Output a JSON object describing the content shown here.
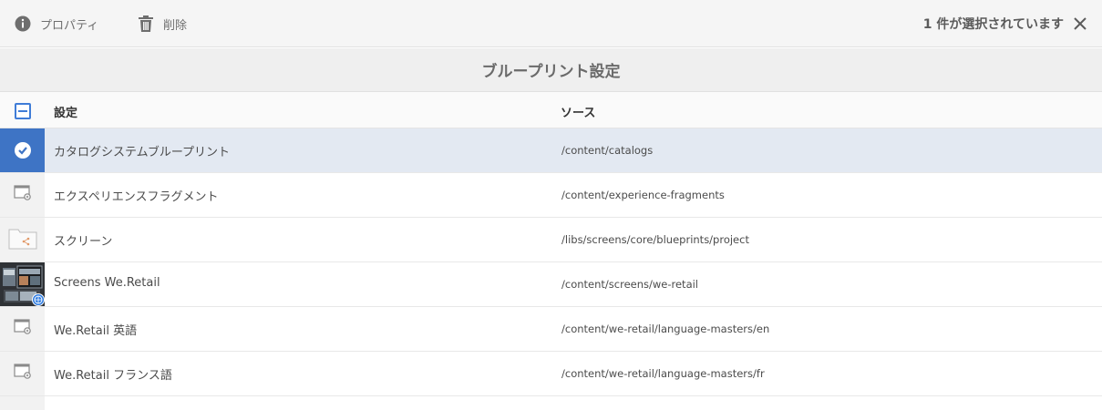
{
  "actionbar": {
    "properties_label": "プロパティ",
    "delete_label": "削除",
    "selection_text": "1 件が選択されています"
  },
  "title": "ブループリント設定",
  "table": {
    "headers": {
      "setting": "設定",
      "source": "ソース"
    },
    "rows": [
      {
        "name": "カタログシステムブループリント",
        "source": "/content/catalogs",
        "selected": true,
        "icon": "checkmark-circle-icon"
      },
      {
        "name": "エクスペリエンスフラグメント",
        "source": "/content/experience-fragments",
        "selected": false,
        "icon": "page-gear-icon"
      },
      {
        "name": "スクリーン",
        "source": "/libs/screens/core/blueprints/project",
        "selected": false,
        "icon": "folder-share-icon"
      },
      {
        "name": "Screens We.Retail",
        "source": "/content/screens/we-retail",
        "selected": false,
        "icon": "screens-thumbnail"
      },
      {
        "name": "We.Retail 英語",
        "source": "/content/we-retail/language-masters/en",
        "selected": false,
        "icon": "page-gear-icon"
      },
      {
        "name": "We.Retail フランス語",
        "source": "/content/we-retail/language-masters/fr",
        "selected": false,
        "icon": "page-gear-icon"
      }
    ]
  },
  "colors": {
    "accent": "#3e74c5",
    "selected_row": "#e3e9f2",
    "header_bg": "#efefef"
  }
}
